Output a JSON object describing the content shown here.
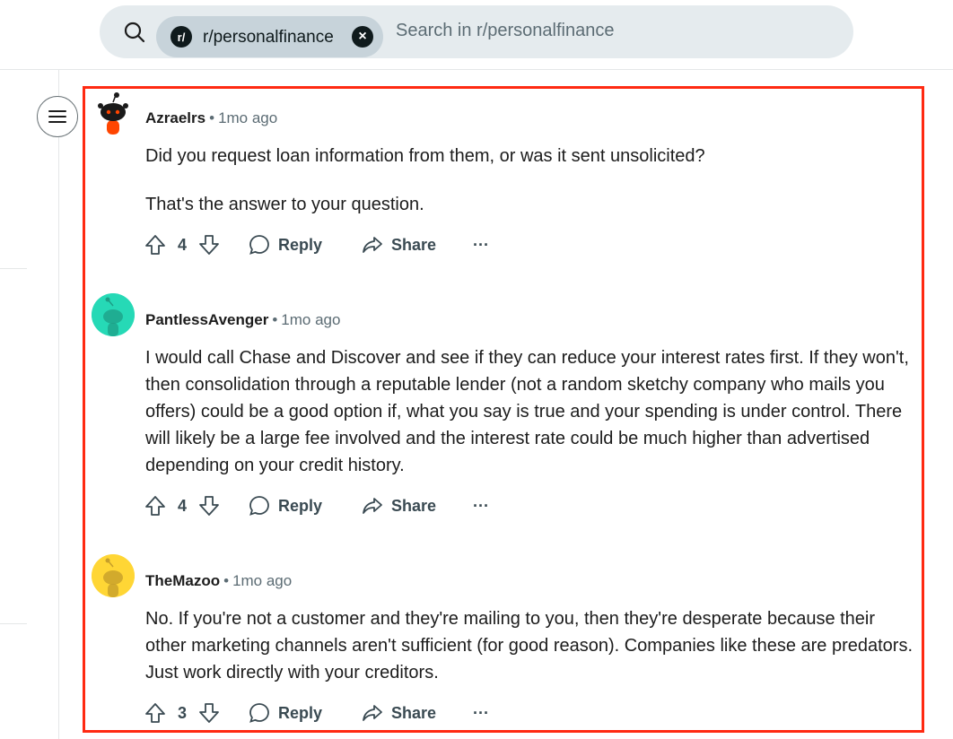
{
  "search": {
    "community_chip": "r/personalfinance",
    "community_logo": "r/",
    "placeholder": "Search in r/personalfinance"
  },
  "comments": [
    {
      "author": "Azraelrs",
      "time": "1mo ago",
      "avatar_color": "#ffffff",
      "paragraphs": [
        "Did you request loan information from them, or was it sent unsolicited?",
        "That's the answer to your question."
      ],
      "votes": "4",
      "reply_label": "Reply",
      "share_label": "Share",
      "more_label": "···"
    },
    {
      "author": "PantlessAvenger",
      "time": "1mo ago",
      "avatar_color": "#26d9b6",
      "paragraphs": [
        "I would call Chase and Discover and see if they can reduce your interest rates first. If they won't, then consolidation through a reputable lender (not a random sketchy company who mails you offers) could be a good option if, what you say is true and your spending is under control. There will likely be a large fee involved and the interest rate could be much higher than advertised depending on your credit history."
      ],
      "votes": "4",
      "reply_label": "Reply",
      "share_label": "Share",
      "more_label": "···"
    },
    {
      "author": "TheMazoo",
      "time": "1mo ago",
      "avatar_color": "#ffd635",
      "paragraphs": [
        "No. If you're not a customer and they're mailing to you, then they're desperate because their other marketing channels aren't sufficient (for good reason). Companies like these are predators. Just work directly with your creditors."
      ],
      "votes": "3",
      "reply_label": "Reply",
      "share_label": "Share",
      "more_label": "···"
    }
  ],
  "colors": {
    "highlight_border": "#ff2a12",
    "search_bg": "#e5ebee",
    "chip_bg": "#c7d3da"
  }
}
